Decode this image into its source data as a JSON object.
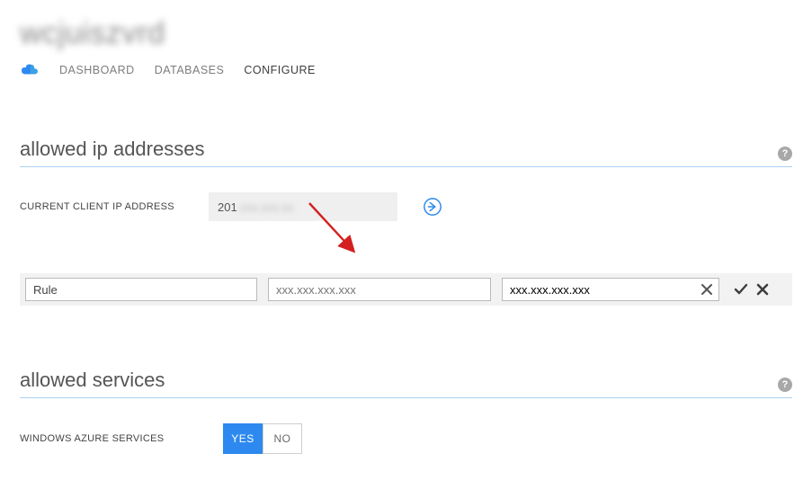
{
  "header": {
    "title_blurred": "wcjuiszvrd"
  },
  "tabs": {
    "dashboard": "DASHBOARD",
    "databases": "DATABASES",
    "configure": "CONFIGURE",
    "active": "configure"
  },
  "sections": {
    "allowed_ip": {
      "title": "allowed ip addresses",
      "current_label": "CURRENT CLIENT IP ADDRESS",
      "current_ip_prefix": "201",
      "current_ip_rest_blurred": ".xxx.xxx.xx",
      "rule_inputs": {
        "name_value": "Rule",
        "start_placeholder": "xxx.xxx.xxx.xxx",
        "end_value": "xxx.xxx.xxx.xxx"
      }
    },
    "allowed_services": {
      "title": "allowed services",
      "label": "WINDOWS AZURE SERVICES",
      "yes": "YES",
      "no": "NO",
      "selected": "yes"
    }
  },
  "icons": {
    "help": "?"
  }
}
